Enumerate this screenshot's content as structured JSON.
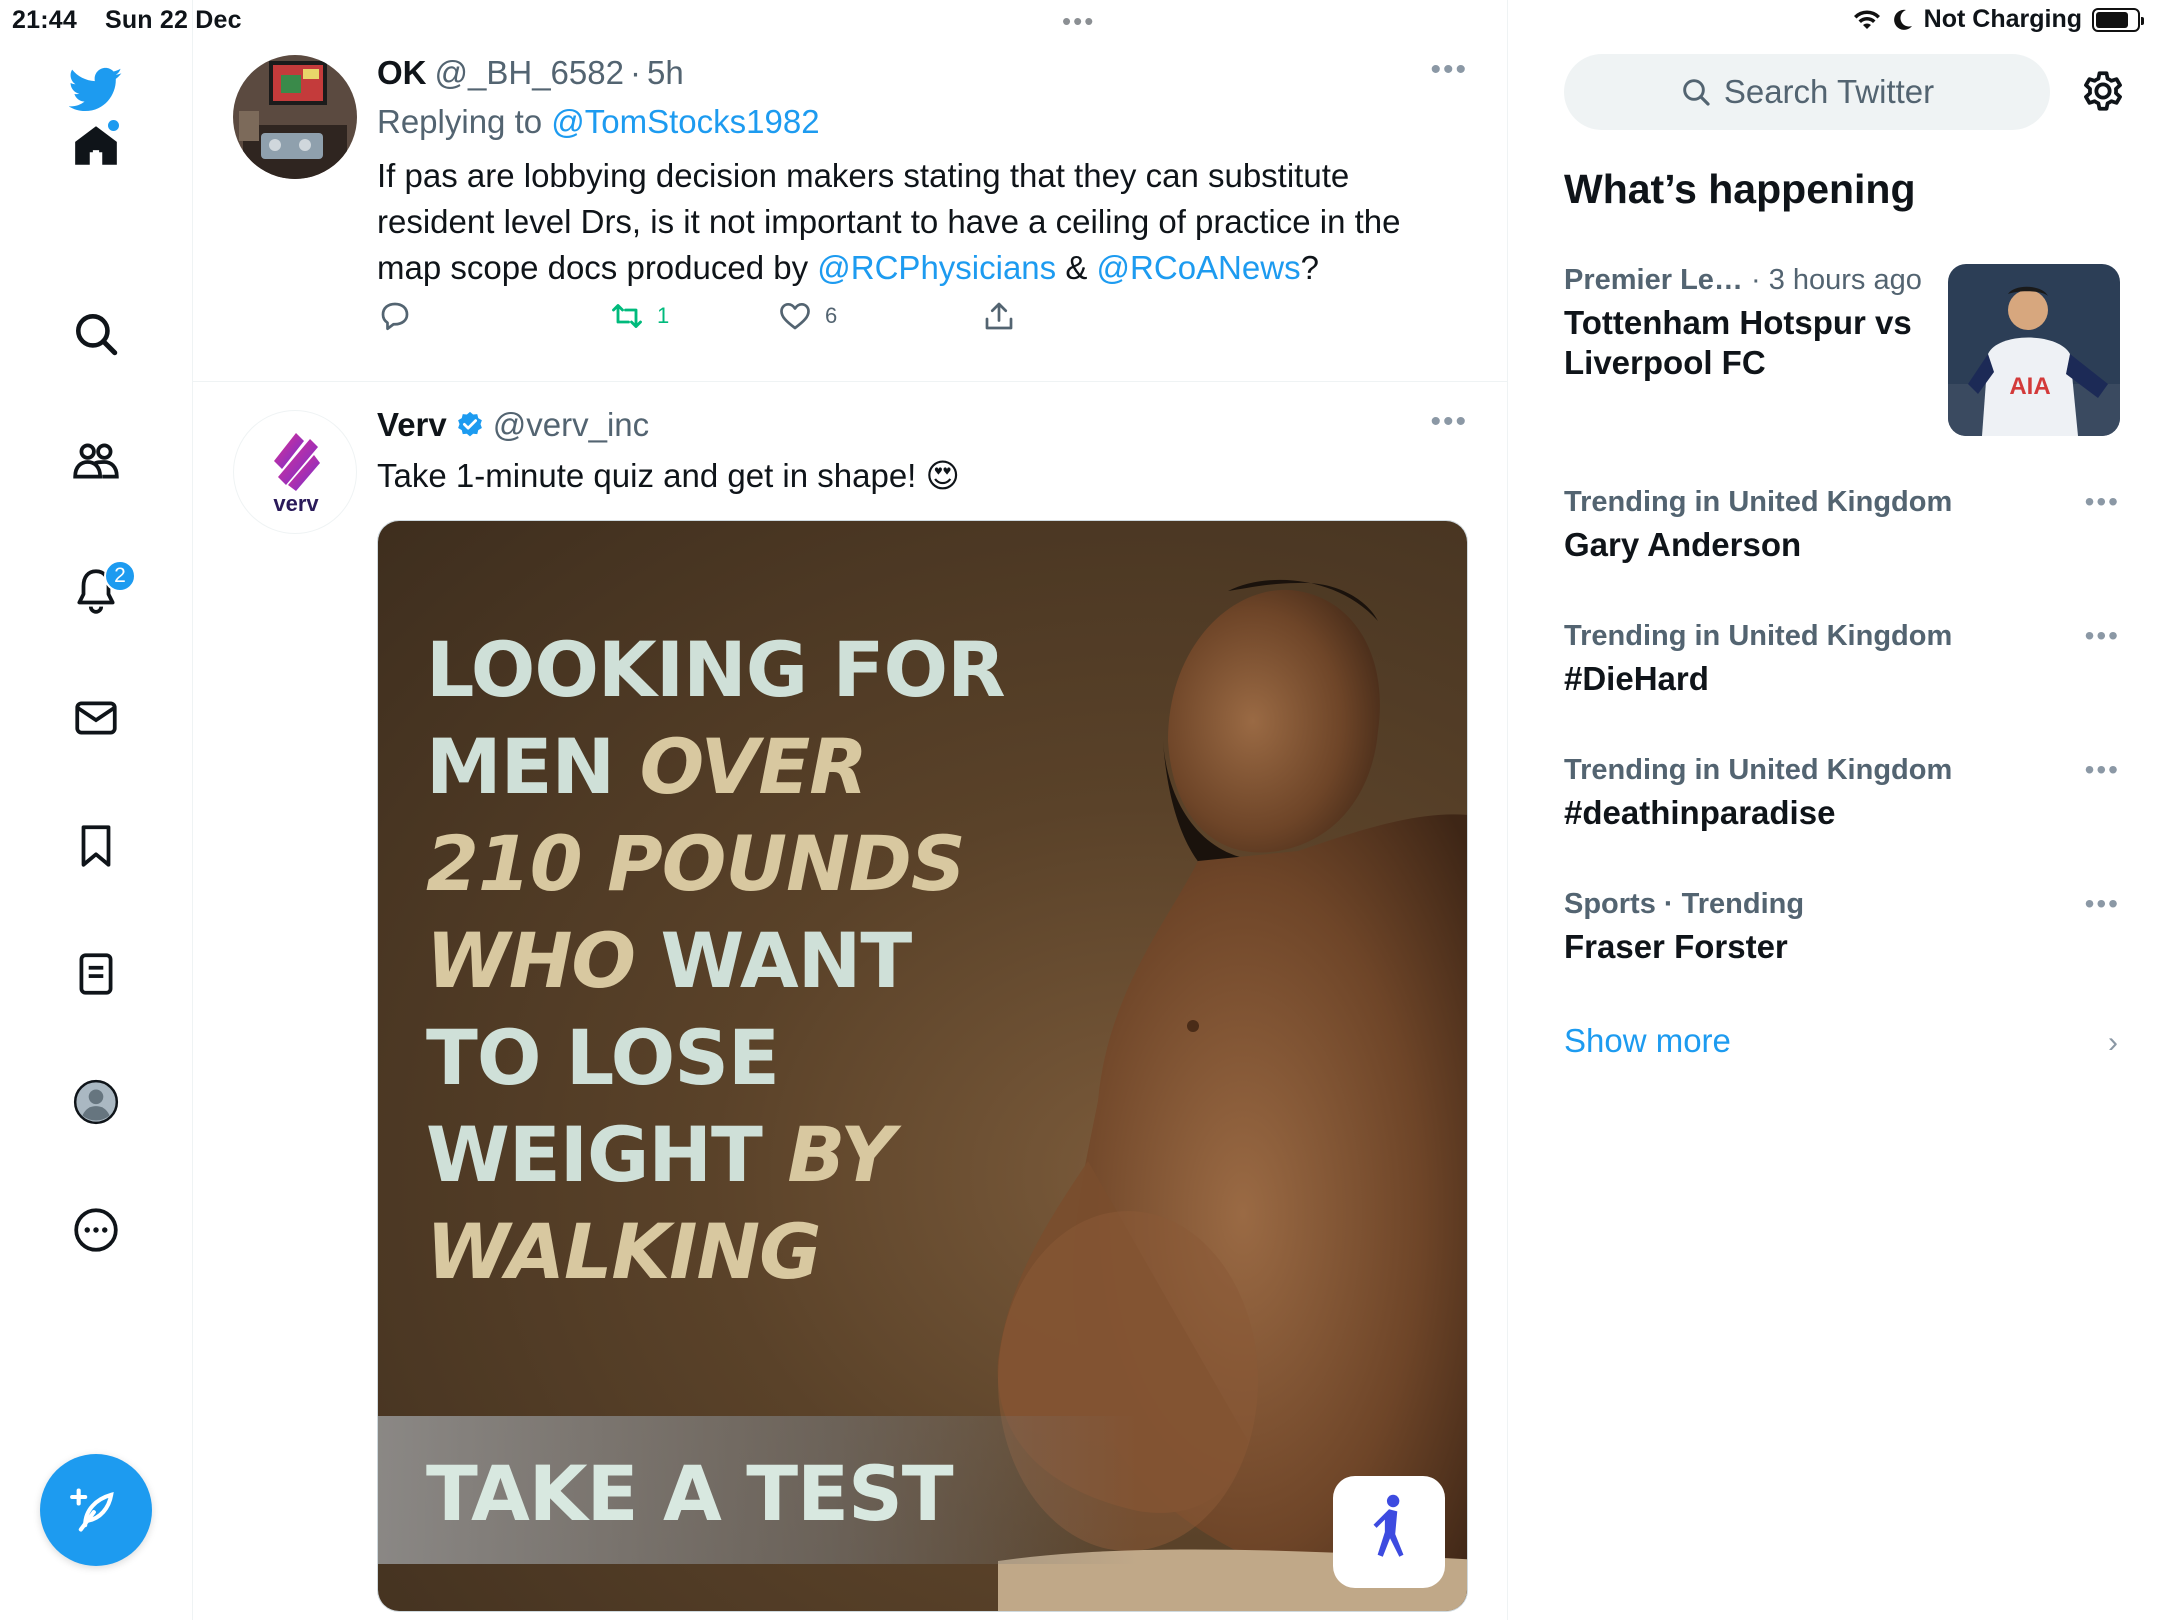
{
  "status_bar": {
    "time": "21:44",
    "date": "Sun 22 Dec",
    "center_dots": "•••",
    "battery_status": "Not Charging",
    "icons": [
      "wifi-icon",
      "moon-icon",
      "battery-icon"
    ]
  },
  "nav": {
    "items": [
      {
        "name": "twitter-logo-icon"
      },
      {
        "name": "home-icon"
      },
      {
        "name": "search-icon"
      },
      {
        "name": "communities-icon"
      },
      {
        "name": "notifications-icon"
      },
      {
        "name": "messages-icon"
      },
      {
        "name": "bookmarks-icon"
      },
      {
        "name": "lists-icon"
      },
      {
        "name": "profile-icon"
      },
      {
        "name": "more-icon"
      }
    ],
    "notification_count": "2",
    "compose_icon": "compose-icon",
    "accent": "#1d9bf0"
  },
  "timeline": {
    "tweets": [
      {
        "name": "OK",
        "handle": "@_BH_6582",
        "sep": "·",
        "time": "5h",
        "more": "•••",
        "replying_prefix": "Replying to",
        "replying_to": "@TomStocks1982",
        "text_1": "If pas are lobbying decision makers stating that they can substitute resident level Drs, is it not important to have a ceiling of practice in the map scope docs produced by ",
        "mention_1": "@RCPhysicians",
        "text_2": " & ",
        "mention_2": "@RCoANews",
        "text_3": "?",
        "retweets": "1",
        "likes": "6"
      },
      {
        "name": "Verv",
        "handle": "@verv_inc",
        "more": "•••",
        "avatar_text": "verv",
        "text": "Take 1-minute quiz and get in shape! 😍",
        "media": {
          "headline": [
            {
              "plain": "LOOKING FOR",
              "em": ""
            },
            {
              "plain": "MEN ",
              "em": "OVER"
            },
            {
              "plain": "",
              "em": "210 POUNDS"
            },
            {
              "plain": " WANT",
              "em": "WHO"
            },
            {
              "plain": "TO LOSE",
              "em": ""
            },
            {
              "plain": "WEIGHT ",
              "em": "BY"
            },
            {
              "plain": "",
              "em": "WALKING"
            }
          ],
          "cta": "TAKE A TEST"
        }
      }
    ]
  },
  "sidebar": {
    "search_placeholder": "Search Twitter",
    "title": "What’s happening",
    "trends": [
      {
        "meta": "Premier Le…",
        "meta_extra": " · 3 hours ago",
        "name": "Tottenham Hotspur vs Liverpool FC",
        "has_thumb": true
      },
      {
        "meta": "Trending in United Kingdom",
        "name": "Gary Anderson",
        "more": "•••"
      },
      {
        "meta": "Trending in United Kingdom",
        "name": "#DieHard",
        "more": "•••"
      },
      {
        "meta": "Trending in United Kingdom",
        "name": "#deathinparadise",
        "more": "•••"
      },
      {
        "meta": "Sports · Trending",
        "name": "Fraser Forster",
        "more": "•••"
      }
    ],
    "show_more": "Show more",
    "chevron": "›",
    "thumb_text": "AIA"
  }
}
